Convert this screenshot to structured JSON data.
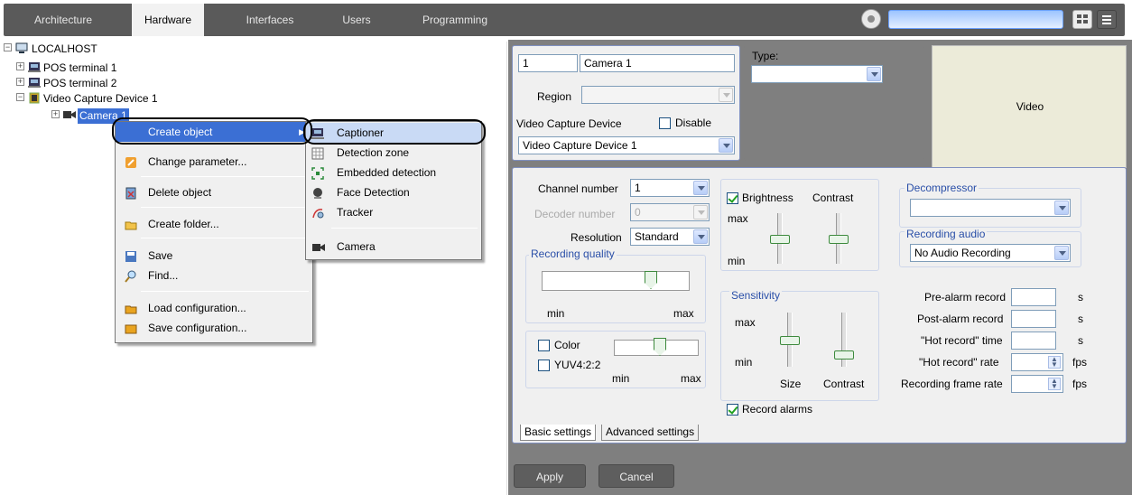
{
  "topbar": {
    "tabs": [
      "Architecture",
      "Hardware",
      "Interfaces",
      "Users",
      "Programming"
    ],
    "active_tab": "Hardware"
  },
  "tree": {
    "root": "LOCALHOST",
    "items": [
      "POS terminal 1",
      "POS terminal 2",
      "Video Capture Device 1",
      "Camera 1"
    ]
  },
  "context_menu": {
    "items": [
      "Create object",
      "Change parameter...",
      "Delete object",
      "Create folder...",
      "Save",
      "Find...",
      "Load configuration...",
      "Save configuration..."
    ]
  },
  "submenu": {
    "items": [
      "Captioner",
      "Detection zone",
      "Embedded detection",
      "Face Detection",
      "Tracker",
      "Camera"
    ]
  },
  "camera_panel": {
    "id_value": "1",
    "name_value": "Camera 1",
    "type_label": "Type:",
    "region_label": "Region",
    "vcd_label": "Video Capture Device",
    "disable_label": "Disable",
    "vcd_value": "Video Capture Device 1",
    "video_label": "Video"
  },
  "settings": {
    "channel_number_label": "Channel number",
    "channel_number_value": "1",
    "decoder_number_label": "Decoder number",
    "decoder_number_value": "0",
    "resolution_label": "Resolution",
    "resolution_value": "Standard",
    "recording_quality_label": "Recording quality",
    "min": "min",
    "max": "max",
    "color_label": "Color",
    "yuv_label": "YUV4:2:2",
    "brightness_label": "Brightness",
    "contrast_label": "Contrast",
    "sensitivity_label": "Sensitivity",
    "size_label": "Size",
    "record_alarms_label": "Record alarms",
    "decompressor_label": "Decompressor",
    "recording_audio_label": "Recording audio",
    "recording_audio_value": "No Audio Recording",
    "pre_alarm_label": "Pre-alarm record",
    "post_alarm_label": "Post-alarm record",
    "hot_time_label": "\"Hot record\" time",
    "hot_rate_label": "\"Hot record\" rate",
    "frame_rate_label": "Recording frame rate",
    "unit_s": "s",
    "unit_fps": "fps",
    "tab_basic": "Basic settings",
    "tab_advanced": "Advanced settings"
  },
  "buttons": {
    "apply": "Apply",
    "cancel": "Cancel"
  }
}
